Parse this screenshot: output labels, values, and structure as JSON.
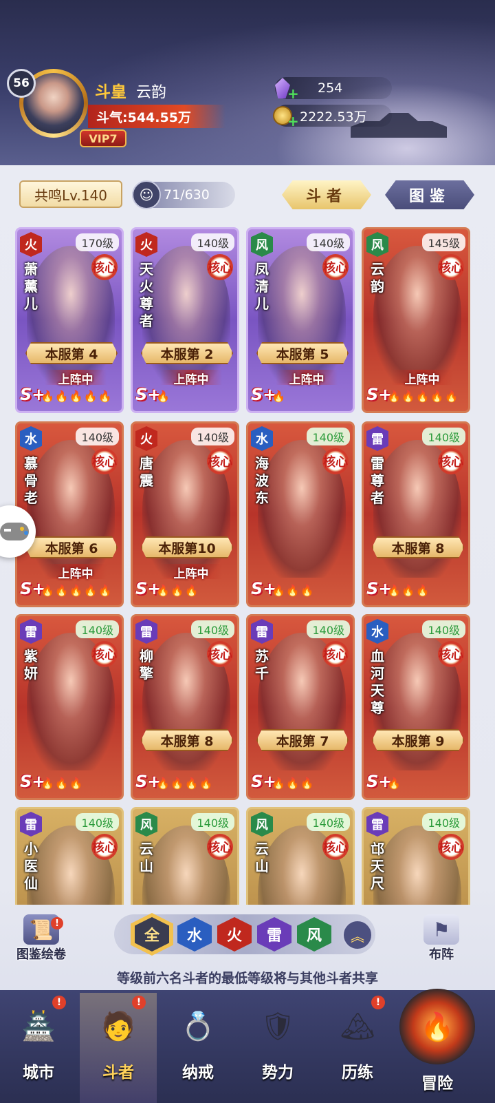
{
  "player": {
    "level": "56",
    "rank_title": "斗皇",
    "name": "云韵",
    "power": "斗气:544.55万",
    "vip": "VIP7"
  },
  "resources": {
    "gem": "254",
    "gold": "2222.53万"
  },
  "subbar": {
    "resonance": "共鸣Lv.140",
    "hero_count": "71/630",
    "tab_fighters": "斗者",
    "tab_codex": "图鉴"
  },
  "core_label": "核心",
  "deploy_label": "上阵中",
  "splus": "S+",
  "cards": [
    {
      "element": "火",
      "elem_color": "fire",
      "level": "170级",
      "name": "萧薰儿",
      "server_rank": "本服第 4",
      "deployed": true,
      "flames": "🔥🔥🔥🔥🔥",
      "frame": "purple",
      "level_green": false
    },
    {
      "element": "火",
      "elem_color": "fire",
      "level": "140级",
      "name": "天火尊者",
      "server_rank": "本服第 2",
      "deployed": true,
      "flames": "🔥",
      "frame": "purple",
      "level_green": false
    },
    {
      "element": "风",
      "elem_color": "wind",
      "level": "140级",
      "name": "凤清儿",
      "server_rank": "本服第 5",
      "deployed": true,
      "flames": "🔥",
      "frame": "purple",
      "level_green": false
    },
    {
      "element": "风",
      "elem_color": "wind",
      "level": "145级",
      "name": "云韵",
      "server_rank": "",
      "deployed": true,
      "flames": "🔥🔥🔥🔥🔥",
      "frame": "red",
      "level_green": false
    },
    {
      "element": "水",
      "elem_color": "water",
      "level": "140级",
      "name": "慕骨老",
      "server_rank": "本服第 6",
      "deployed": true,
      "flames": "🔥🔥🔥🔥🔥",
      "frame": "red",
      "level_green": false
    },
    {
      "element": "火",
      "elem_color": "fire",
      "level": "140级",
      "name": "唐震",
      "server_rank": "本服第10",
      "deployed": true,
      "flames": "🔥🔥🔥",
      "frame": "red",
      "level_green": false
    },
    {
      "element": "水",
      "elem_color": "water",
      "level": "140级",
      "name": "海波东",
      "server_rank": "",
      "deployed": false,
      "flames": "🔥🔥🔥",
      "frame": "red",
      "level_green": true
    },
    {
      "element": "雷",
      "elem_color": "thunder",
      "level": "140级",
      "name": "雷尊者",
      "server_rank": "本服第 8",
      "deployed": false,
      "flames": "🔥🔥🔥",
      "frame": "red",
      "level_green": true
    },
    {
      "element": "雷",
      "elem_color": "thunder",
      "level": "140级",
      "name": "紫妍",
      "server_rank": "",
      "deployed": false,
      "flames": "🔥🔥🔥",
      "frame": "red",
      "level_green": true
    },
    {
      "element": "雷",
      "elem_color": "thunder",
      "level": "140级",
      "name": "柳擎",
      "server_rank": "本服第 8",
      "deployed": false,
      "flames": "🔥🔥🔥🔥",
      "frame": "red",
      "level_green": true
    },
    {
      "element": "雷",
      "elem_color": "thunder",
      "level": "140级",
      "name": "苏千",
      "server_rank": "本服第 7",
      "deployed": false,
      "flames": "🔥🔥🔥",
      "frame": "red",
      "level_green": true
    },
    {
      "element": "水",
      "elem_color": "water",
      "level": "140级",
      "name": "血河天尊",
      "server_rank": "本服第 9",
      "deployed": false,
      "flames": "🔥",
      "frame": "red",
      "level_green": true
    },
    {
      "element": "雷",
      "elem_color": "thunder",
      "level": "140级",
      "name": "小医仙",
      "server_rank": "",
      "deployed": false,
      "flames": "",
      "frame": "gold",
      "level_green": true
    },
    {
      "element": "风",
      "elem_color": "wind",
      "level": "140级",
      "name": "云山",
      "server_rank": "",
      "deployed": false,
      "flames": "",
      "frame": "gold",
      "level_green": true
    },
    {
      "element": "风",
      "elem_color": "wind",
      "level": "140级",
      "name": "云山",
      "server_rank": "",
      "deployed": false,
      "flames": "",
      "frame": "gold",
      "level_green": true
    },
    {
      "element": "雷",
      "elem_color": "thunder",
      "level": "140级",
      "name": "邙天尺",
      "server_rank": "",
      "deployed": false,
      "flames": "",
      "frame": "gold",
      "level_green": true
    }
  ],
  "filter": {
    "all": "全",
    "water": "水",
    "fire": "火",
    "thunder": "雷",
    "wind": "风"
  },
  "side": {
    "codex_label": "图鉴绘卷",
    "formation_label": "布阵",
    "badge": "!"
  },
  "tip": "等级前六名斗者的最低等级将与其他斗者共享",
  "nav": [
    {
      "label": "城市",
      "badge": "!",
      "icon": "city-icon"
    },
    {
      "label": "斗者",
      "badge": "!",
      "icon": "fighter-icon"
    },
    {
      "label": "纳戒",
      "badge": "",
      "icon": "ring-icon"
    },
    {
      "label": "势力",
      "badge": "",
      "icon": "faction-icon"
    },
    {
      "label": "历练",
      "badge": "!",
      "icon": "training-icon"
    },
    {
      "label": "冒险",
      "badge": "",
      "icon": "adventure-icon"
    }
  ]
}
